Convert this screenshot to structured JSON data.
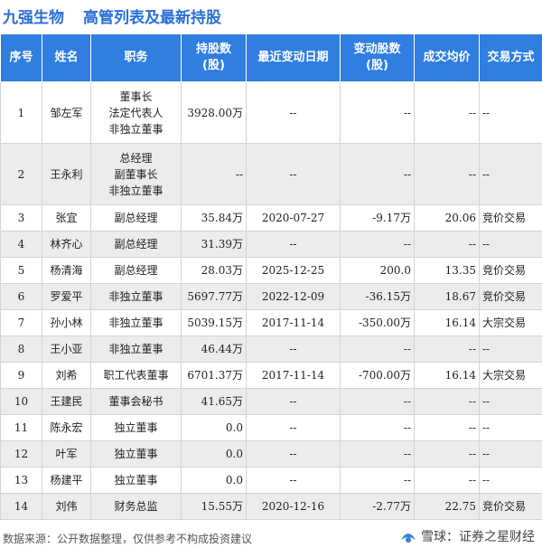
{
  "header": {
    "company": "九强生物",
    "subtitle": "高管列表及最新持股"
  },
  "table": {
    "columns": [
      "序号",
      "姓名",
      "职务",
      "持股数\n(股)",
      "最近变动日期",
      "变动股数\n(股)",
      "成交均价",
      "交易方式"
    ],
    "rows": [
      {
        "no": "1",
        "name": "邹左军",
        "roles": [
          "董事长",
          "法定代表人",
          "非独立董事"
        ],
        "shares": "3928.00万",
        "date": "--",
        "change": "--",
        "change_dir": "none",
        "price": "--",
        "price_dir": "none",
        "method": "--"
      },
      {
        "no": "2",
        "name": "王永利",
        "roles": [
          "总经理",
          "副董事长",
          "非独立董事"
        ],
        "shares": "--",
        "date": "--",
        "change": "--",
        "change_dir": "none",
        "price": "--",
        "price_dir": "none",
        "method": "--"
      },
      {
        "no": "3",
        "name": "张宜",
        "roles": [
          "副总经理"
        ],
        "shares": "35.84万",
        "date": "2020-07-27",
        "change": "-9.17万",
        "change_dir": "down",
        "price": "20.06",
        "price_dir": "down",
        "method": "竞价交易"
      },
      {
        "no": "4",
        "name": "林齐心",
        "roles": [
          "副总经理"
        ],
        "shares": "31.39万",
        "date": "--",
        "change": "--",
        "change_dir": "none",
        "price": "--",
        "price_dir": "none",
        "method": "--"
      },
      {
        "no": "5",
        "name": "杨清海",
        "roles": [
          "副总经理"
        ],
        "shares": "28.03万",
        "date": "2025-12-25",
        "change": "200.0",
        "change_dir": "up",
        "price": "13.35",
        "price_dir": "up",
        "method": "竞价交易"
      },
      {
        "no": "6",
        "name": "罗爱平",
        "roles": [
          "非独立董事"
        ],
        "shares": "5697.77万",
        "date": "2022-12-09",
        "change": "-36.15万",
        "change_dir": "down",
        "price": "18.67",
        "price_dir": "down",
        "method": "竞价交易"
      },
      {
        "no": "7",
        "name": "孙小林",
        "roles": [
          "非独立董事"
        ],
        "shares": "5039.15万",
        "date": "2017-11-14",
        "change": "-350.00万",
        "change_dir": "down",
        "price": "16.14",
        "price_dir": "down",
        "method": "大宗交易"
      },
      {
        "no": "8",
        "name": "王小亚",
        "roles": [
          "非独立董事"
        ],
        "shares": "46.44万",
        "date": "--",
        "change": "--",
        "change_dir": "none",
        "price": "--",
        "price_dir": "none",
        "method": "--"
      },
      {
        "no": "9",
        "name": "刘希",
        "roles": [
          "职工代表董事"
        ],
        "shares": "6701.37万",
        "date": "2017-11-14",
        "change": "-700.00万",
        "change_dir": "down",
        "price": "16.14",
        "price_dir": "down",
        "method": "大宗交易"
      },
      {
        "no": "10",
        "name": "王建民",
        "roles": [
          "董事会秘书"
        ],
        "shares": "41.65万",
        "date": "--",
        "change": "--",
        "change_dir": "none",
        "price": "--",
        "price_dir": "none",
        "method": "--"
      },
      {
        "no": "11",
        "name": "陈永宏",
        "roles": [
          "独立董事"
        ],
        "shares": "0.0",
        "date": "--",
        "change": "--",
        "change_dir": "none",
        "price": "--",
        "price_dir": "none",
        "method": "--"
      },
      {
        "no": "12",
        "name": "叶军",
        "roles": [
          "独立董事"
        ],
        "shares": "0.0",
        "date": "--",
        "change": "--",
        "change_dir": "none",
        "price": "--",
        "price_dir": "none",
        "method": "--"
      },
      {
        "no": "13",
        "name": "杨建平",
        "roles": [
          "独立董事"
        ],
        "shares": "0.0",
        "date": "--",
        "change": "--",
        "change_dir": "none",
        "price": "--",
        "price_dir": "none",
        "method": "--"
      },
      {
        "no": "14",
        "name": "刘伟",
        "roles": [
          "财务总监"
        ],
        "shares": "15.55万",
        "date": "2020-12-16",
        "change": "-2.77万",
        "change_dir": "down",
        "price": "22.75",
        "price_dir": "down",
        "method": "竞价交易"
      }
    ]
  },
  "footer": {
    "source": "数据来源：公开数据整理，仅供参考不构成投资建议",
    "brand": "雪球：证券之星财经",
    "logo_icon": "snowball-logo-icon"
  },
  "colors": {
    "title": "#2a6fd6",
    "header_bg": "#2f7ee0",
    "up": "#e02020",
    "down": "#1a9a1a"
  }
}
